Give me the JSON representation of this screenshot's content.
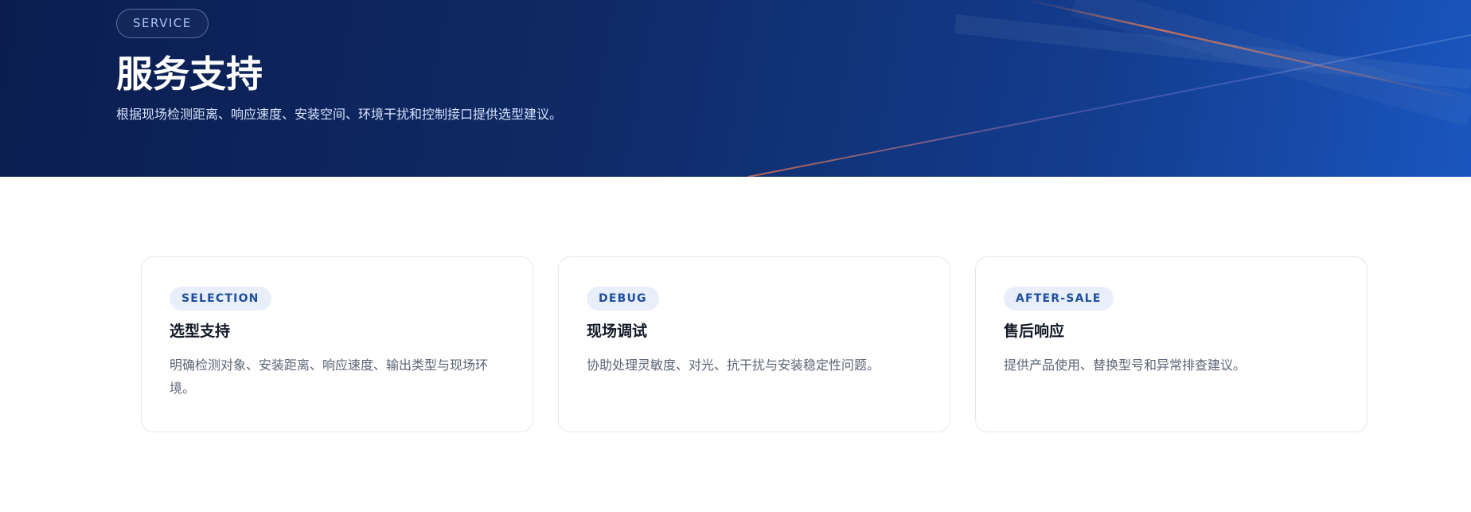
{
  "hero": {
    "badge": "SERVICE",
    "title": "服务支持",
    "subtitle": "根据现场检测距离、响应速度、安装空间、环境干扰和控制接口提供选型建议。"
  },
  "cards": [
    {
      "tag": "SELECTION",
      "title": "选型支持",
      "description": "明确检测对象、安装距离、响应速度、输出类型与现场环境。"
    },
    {
      "tag": "DEBUG",
      "title": "现场调试",
      "description": "协助处理灵敏度、对光、抗干扰与安装稳定性问题。"
    },
    {
      "tag": "AFTER-SALE",
      "title": "售后响应",
      "description": "提供产品使用、替换型号和异常排查建议。"
    }
  ],
  "colors": {
    "hero_start": "#0b1d4f",
    "hero_end": "#1a56bf",
    "accent_line": "#e0744a",
    "tag_bg": "#e9effa",
    "tag_text": "#1f4f9e"
  }
}
